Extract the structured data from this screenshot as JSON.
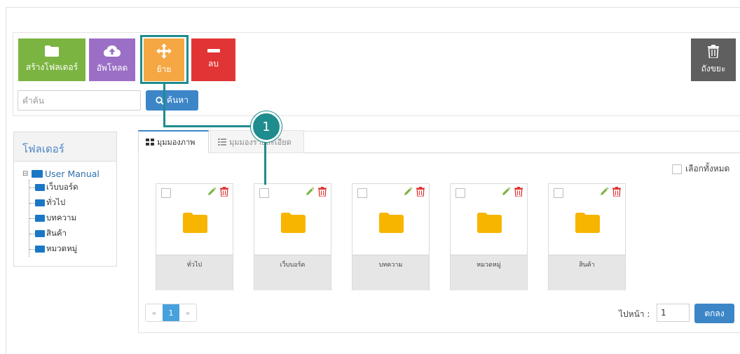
{
  "toolbar": {
    "create_folder": "สร้างโฟลเดอร์",
    "upload": "อัพโหลด",
    "move": "ย้าย",
    "delete": "ลบ",
    "trash": "ถังขยะ"
  },
  "search": {
    "placeholder": "คำค้น",
    "button": "ค้นหา"
  },
  "folder_panel": {
    "title": "โฟลเดอร์",
    "root": "User Manual",
    "children": [
      "เว็บบอร์ด",
      "ทั่วไป",
      "บทความ",
      "สินค้า",
      "หมวดหมู่"
    ]
  },
  "tabs": {
    "grid_view": "มุมมองภาพ",
    "detail_view": "มุมมองรายละเอียด"
  },
  "select_all": "เลือกทั้งหมด",
  "cards": [
    "ทั่วไป",
    "เว็บบอร์ด",
    "บทความ",
    "หมวดหมู่",
    "สินค้า"
  ],
  "pagination": {
    "prev": "«",
    "current": "1",
    "next": "»"
  },
  "goto": {
    "label": "ไปหน้า :",
    "value": "1",
    "button": "ตกลง"
  },
  "callout": {
    "number": "1"
  },
  "colors": {
    "create": "#7bb441",
    "upload": "#9b6fc6",
    "move": "#f4a742",
    "delete": "#e13535",
    "trash": "#5f5f5f",
    "primary": "#3c86c8",
    "callout": "#1f8c8e",
    "folder": "#f7b500"
  }
}
